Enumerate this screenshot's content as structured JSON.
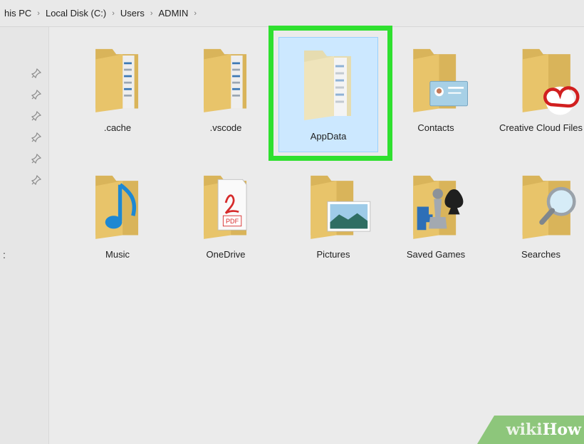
{
  "breadcrumb": {
    "items": [
      "his PC",
      "Local Disk (C:)",
      "Users",
      "ADMIN"
    ],
    "separator": "›"
  },
  "sidebar": {
    "edge_mark": ":"
  },
  "folders": [
    {
      "name": ".cache",
      "overlay": "files"
    },
    {
      "name": ".vscode",
      "overlay": "files"
    },
    {
      "name": "AppData",
      "overlay": "files",
      "selected": true
    },
    {
      "name": "Contacts",
      "overlay": "contact-card"
    },
    {
      "name": "Creative Cloud Files",
      "overlay": "creative-cloud-logo"
    },
    {
      "name": "Music",
      "overlay": "music-note"
    },
    {
      "name": "OneDrive",
      "overlay": "pdf-document"
    },
    {
      "name": "Pictures",
      "overlay": "landscape-photo"
    },
    {
      "name": "Saved Games",
      "overlay": "chess-pieces"
    },
    {
      "name": "Searches",
      "overlay": "magnifier"
    }
  ],
  "watermark": {
    "prefix": "wiki",
    "suffix": "How"
  },
  "colors": {
    "highlight": "#2fe02f",
    "selection": "#cce8ff",
    "folder": "#e8c46a",
    "watermark": "#8dc67b"
  }
}
